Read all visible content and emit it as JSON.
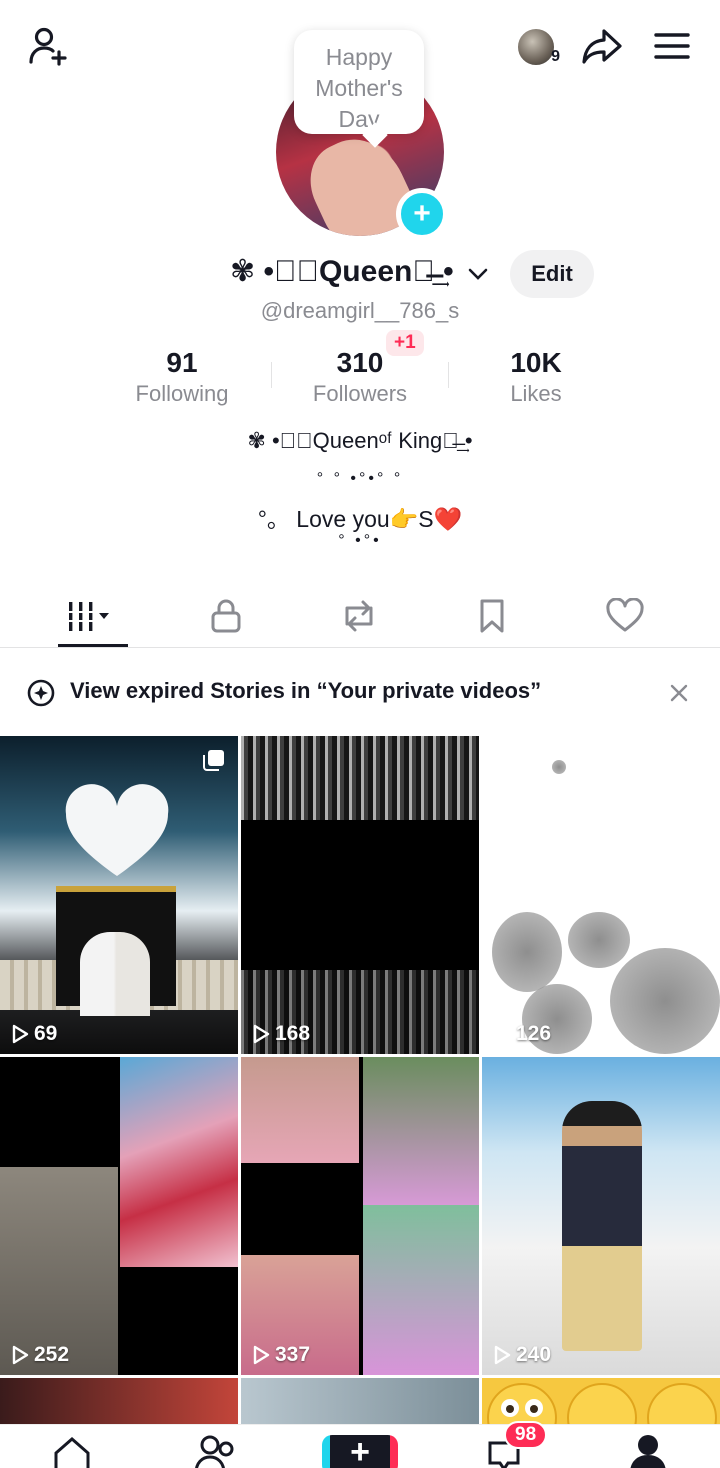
{
  "header": {
    "friends_count": "9",
    "bubble_note": [
      "Happy",
      "Mother's",
      "Day"
    ]
  },
  "profile": {
    "display_name": "✾ •⸮⃝Queen⃚̶͢ •",
    "username": "@dreamgirl__786_s",
    "edit_label": "Edit",
    "new_followers_badge": "+1",
    "stats": [
      {
        "value": "91",
        "label": "Following"
      },
      {
        "value": "310",
        "label": "Followers"
      },
      {
        "value": "10K",
        "label": "Likes"
      }
    ],
    "bio_line1": "✾ •⸮⃝Queenᵒᶠ King⃚̶͢ •",
    "bio_dots1": "° ° •°•° °",
    "bio_line2": "°。 Love you👉S❤️",
    "bio_dots2": "° •°•"
  },
  "tabs": [
    {
      "name": "videos",
      "icon": "grid-icon",
      "active": true
    },
    {
      "name": "private",
      "icon": "lock-icon",
      "active": false
    },
    {
      "name": "reposts",
      "icon": "repost-icon",
      "active": false
    },
    {
      "name": "favorites",
      "icon": "bookmark-icon",
      "active": false
    },
    {
      "name": "liked",
      "icon": "heart-icon",
      "active": false
    }
  ],
  "banner": {
    "text": "View expired Stories in “Your private videos”"
  },
  "videos": [
    {
      "views": "69"
    },
    {
      "views": "168"
    },
    {
      "views": "126"
    },
    {
      "views": "252"
    },
    {
      "views": "337"
    },
    {
      "views": "240"
    }
  ],
  "bottom_nav": {
    "inbox_badge": "98"
  },
  "colors": {
    "accent_cyan": "#20d5ec",
    "accent_red": "#fe2c55",
    "text_primary": "#161823",
    "text_secondary": "#8a8b91"
  }
}
